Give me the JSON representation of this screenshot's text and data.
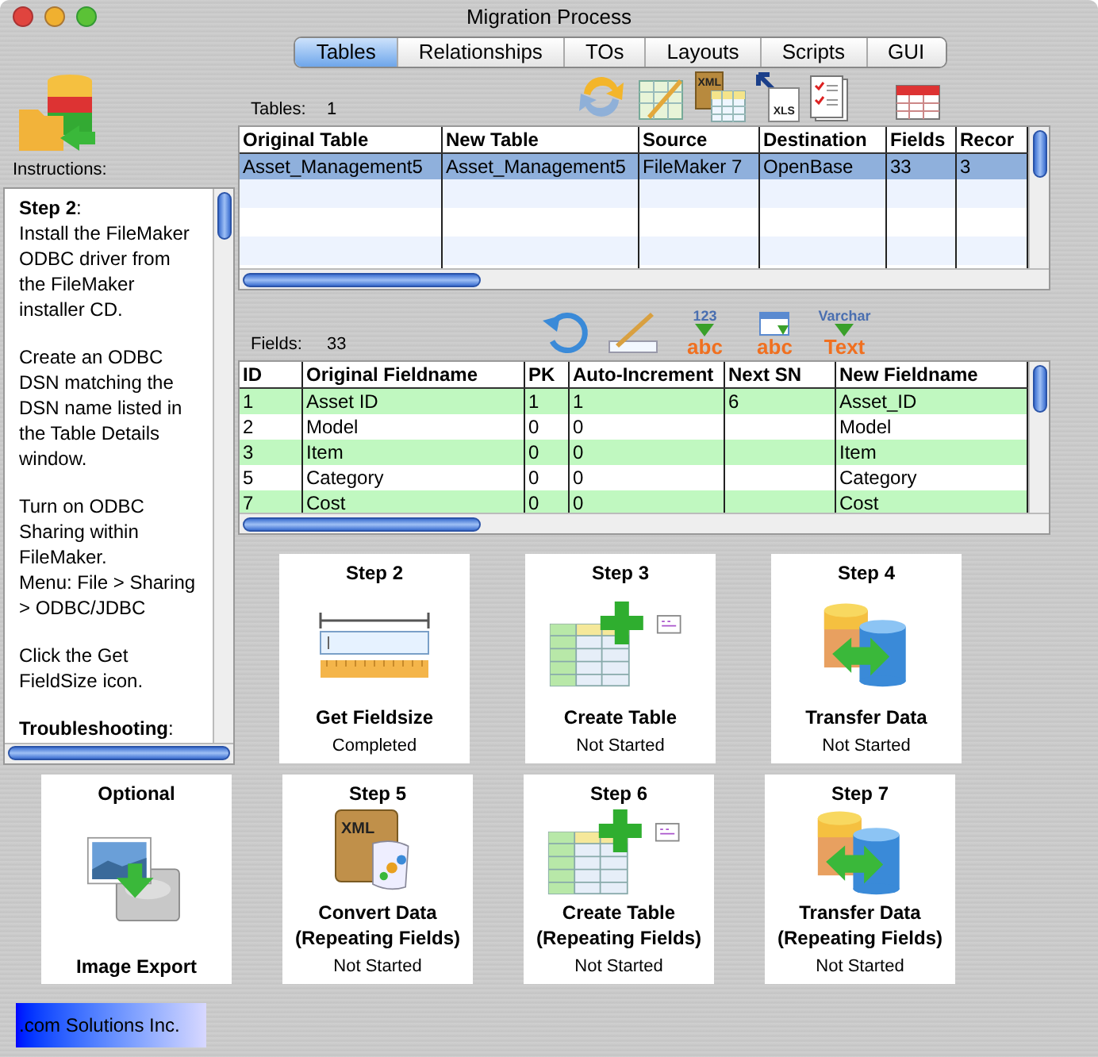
{
  "window": {
    "title": "Migration Process"
  },
  "tabs": [
    {
      "label": "Tables",
      "selected": true
    },
    {
      "label": "Relationships",
      "selected": false
    },
    {
      "label": "TOs",
      "selected": false
    },
    {
      "label": "Layouts",
      "selected": false
    },
    {
      "label": "Scripts",
      "selected": false
    },
    {
      "label": "GUI",
      "selected": false
    }
  ],
  "instructions": {
    "label": "Instructions:",
    "blocks": [
      [
        "**Step 2**:",
        "Install the FileMaker ODBC driver from the FileMaker installer CD."
      ],
      [
        "Create an ODBC DSN matching the DSN name listed in the Table Details window."
      ],
      [
        "Turn on ODBC Sharing within FileMaker.",
        "Menu: File > Sharing > ODBC/JDBC"
      ],
      [
        "Click the Get FieldSize icon."
      ],
      [
        "**Troubleshooting**:"
      ]
    ]
  },
  "tables": {
    "count_label": "Tables:",
    "count": "1",
    "tools": [
      {
        "kind": "sync"
      },
      {
        "kind": "edit-table"
      },
      {
        "kind": "xml-table",
        "label": "XML"
      },
      {
        "kind": "xls",
        "label": "XLS"
      },
      {
        "kind": "checklist"
      },
      {
        "kind": "table-header"
      }
    ],
    "columns": [
      "Original Table",
      "New Table",
      "Source",
      "Destination",
      "Fields",
      "Recor"
    ],
    "rows": [
      {
        "cells": [
          "Asset_Management5",
          "Asset_Management5",
          "FileMaker 7",
          "OpenBase",
          "33",
          "3"
        ],
        "selected": true
      }
    ]
  },
  "fields": {
    "count_label": "Fields:",
    "count": "33",
    "tools": [
      {
        "kind": "undo"
      },
      {
        "kind": "pencil"
      },
      {
        "kind": "convert",
        "from": "123",
        "to": "abc"
      },
      {
        "kind": "convert-date",
        "to": "abc"
      },
      {
        "kind": "convert",
        "from": "Varchar",
        "to": "Text"
      }
    ],
    "columns": [
      "ID",
      "Original Fieldname",
      "PK",
      "Auto-Increment",
      "Next SN",
      "New Fieldname"
    ],
    "rows": [
      {
        "cells": [
          "1",
          "Asset ID",
          "1",
          "1",
          "6",
          "Asset_ID"
        ]
      },
      {
        "cells": [
          "2",
          "Model",
          "0",
          "0",
          "",
          "Model"
        ]
      },
      {
        "cells": [
          "3",
          "Item",
          "0",
          "0",
          "",
          "Item"
        ]
      },
      {
        "cells": [
          "5",
          "Category",
          "0",
          "0",
          "",
          "Category"
        ]
      },
      {
        "cells": [
          "7",
          "Cost",
          "0",
          "0",
          "",
          "Cost"
        ]
      }
    ]
  },
  "steps": [
    [
      {
        "step": "Step 2",
        "kind": "fieldsize",
        "title": "Get Fieldsize",
        "status": "Completed"
      },
      {
        "step": "Step 3",
        "kind": "create-table",
        "title": "Create Table",
        "status": "Not Started"
      },
      {
        "step": "Step 4",
        "kind": "transfer",
        "title": "Transfer Data",
        "status": "Not Started"
      }
    ],
    [
      {
        "step": "Optional",
        "kind": "image-export",
        "title": "Image Export"
      },
      {
        "step": "Step 5",
        "kind": "xml-convert",
        "icon_label": "XML",
        "title": "Convert Data",
        "note": "(Repeating Fields)",
        "status": "Not Started"
      },
      {
        "step": "Step 6",
        "kind": "create-table",
        "title": "Create Table",
        "note": "(Repeating Fields)",
        "status": "Not Started"
      },
      {
        "step": "Step 7",
        "kind": "transfer",
        "title": "Transfer Data",
        "note": "(Repeating Fields)",
        "status": "Not Started"
      }
    ]
  ],
  "company": ".com Solutions Inc."
}
